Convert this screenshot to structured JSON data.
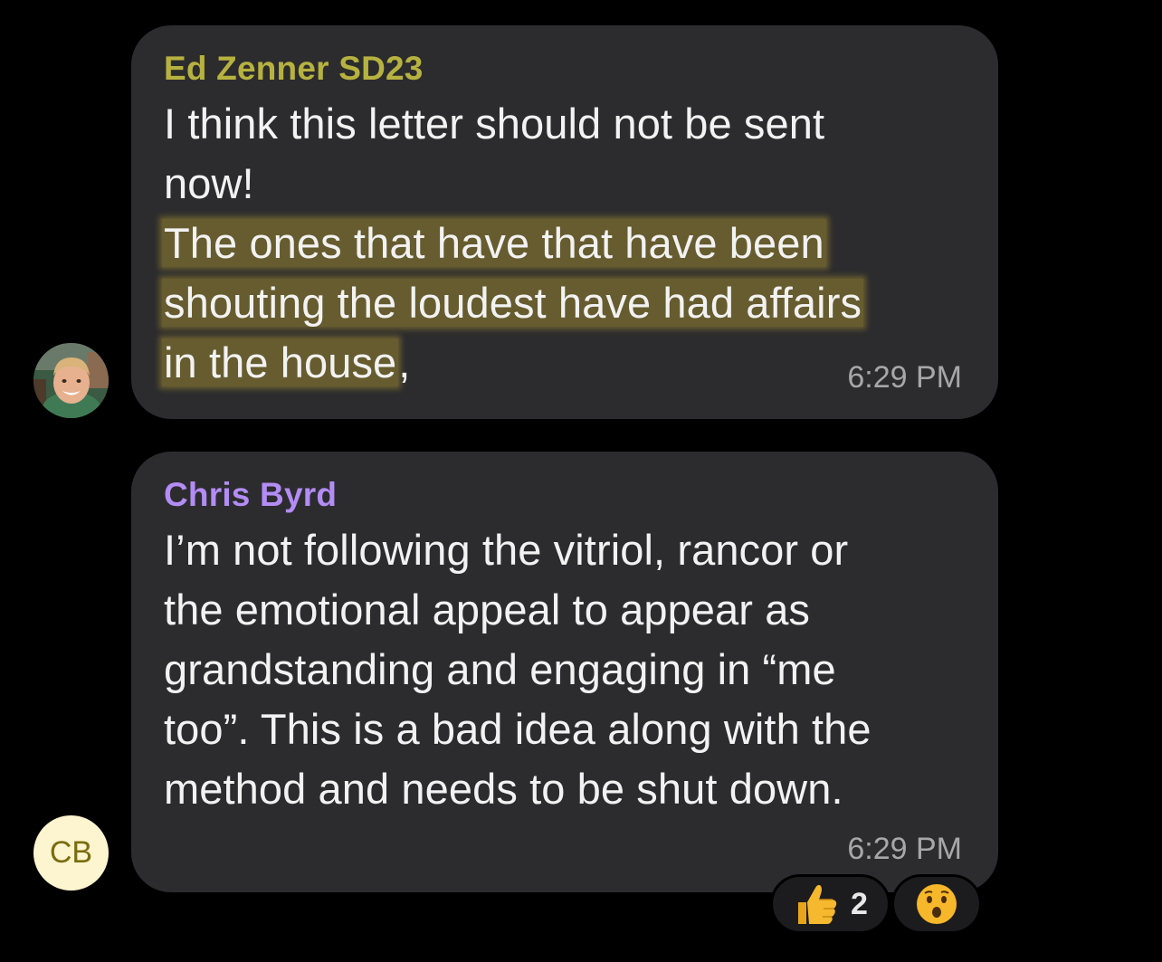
{
  "messages": [
    {
      "sender": "Ed Zenner SD23",
      "sender_color": "#b7b23f",
      "lines": [
        "I think this letter should not be sent",
        "now!"
      ],
      "highlighted_lines": [
        "The ones that have that have been",
        "shouting the loudest have had affairs",
        "in the house"
      ],
      "trailing": ",",
      "time": "6:29 PM",
      "avatar": "photo"
    },
    {
      "sender": "Chris Byrd",
      "sender_color": "#b38cf5",
      "lines": [
        "I’m not following the vitriol, rancor or",
        "the emotional appeal to appear as",
        "grandstanding and engaging in “me",
        "too”. This is a bad idea along with the",
        "method and needs to be shut down."
      ],
      "time": "6:29 PM",
      "avatar_initials": "CB",
      "reactions": [
        {
          "icon": "thumbs-up-icon",
          "count": "2"
        },
        {
          "icon": "surprised-face-icon"
        }
      ]
    }
  ],
  "colors": {
    "background": "#000000",
    "bubble": "#2c2c2e",
    "highlight": "#b9a032",
    "avatar_cb_bg": "#fdf5cf"
  }
}
